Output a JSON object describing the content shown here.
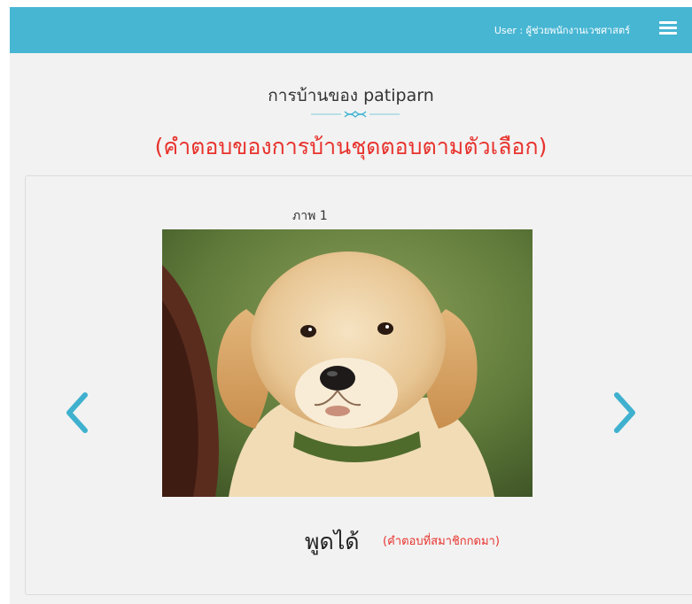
{
  "header": {
    "user_label": "User : ผู้ช่วยพนักงานเวชศาสตร์",
    "menu_icon": "hamburger-menu-icon",
    "bar_color": "#47b6d3"
  },
  "homework": {
    "title": "การบ้านของ patiparn",
    "subtitle": "(คำตอบของการบ้านชุดตอบตามตัวเลือก)",
    "subtitle_color": "#e8322c"
  },
  "slide": {
    "caption": "ภาพ 1",
    "image_subject": "golden retriever puppy",
    "prev_icon": "chevron-left-icon",
    "next_icon": "chevron-right-icon",
    "answer": "พูดได้",
    "answer_note": "(คำตอบที่สมาชิกกดมา)"
  }
}
